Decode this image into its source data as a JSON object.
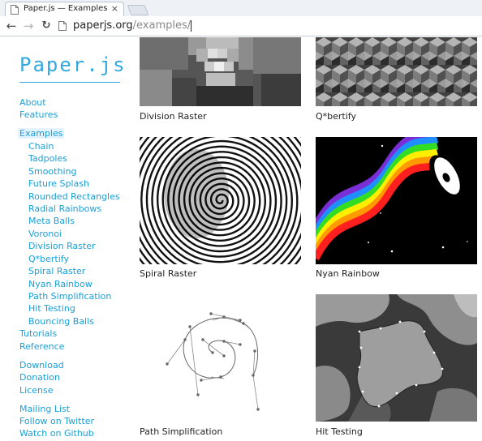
{
  "browser": {
    "tab_title": "Paper.js — Examples",
    "tab_close": "×",
    "url_host": "paperjs.org",
    "url_path": "/examples/"
  },
  "logo": "Paper.js",
  "nav": {
    "about": "About",
    "features": "Features",
    "examples": "Examples",
    "examples_children": [
      "Chain",
      "Tadpoles",
      "Smoothing",
      "Future Splash",
      "Rounded Rectangles",
      "Radial Rainbows",
      "Meta Balls",
      "Voronoi",
      "Division Raster",
      "Q*bertify",
      "Spiral Raster",
      "Nyan Rainbow",
      "Path Simplification",
      "Hit Testing",
      "Bouncing Balls"
    ],
    "tutorials": "Tutorials",
    "reference": "Reference",
    "download": "Download",
    "donation": "Donation",
    "license": "License",
    "mailing_list": "Mailing List",
    "twitter": "Follow on Twitter",
    "github": "Watch on Github"
  },
  "examples": [
    {
      "caption": "Division Raster"
    },
    {
      "caption": "Q*bertify"
    },
    {
      "caption": "Spiral Raster"
    },
    {
      "caption": "Nyan Rainbow"
    },
    {
      "caption": "Path Simplification"
    },
    {
      "caption": "Hit Testing"
    }
  ],
  "colors": {
    "accent": "#33a8df",
    "link": "#1a9fd8"
  }
}
